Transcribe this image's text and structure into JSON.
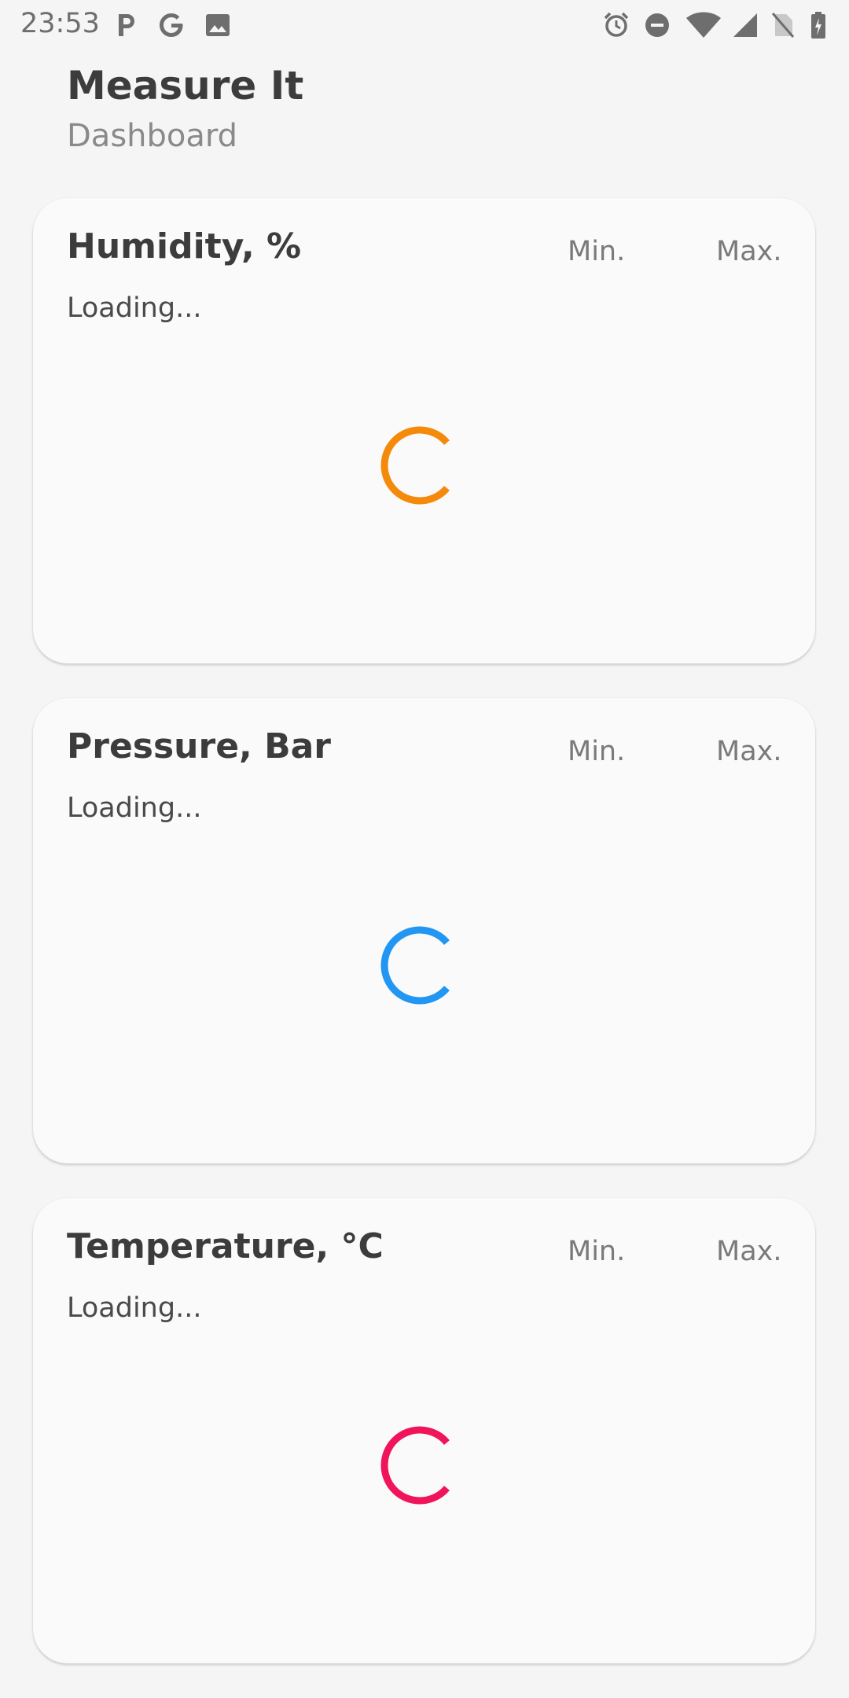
{
  "status_bar": {
    "time": "23:53",
    "left_icons": [
      "parking-icon",
      "google-icon",
      "image-icon"
    ],
    "right_icons": [
      "alarm-icon",
      "do-not-disturb-icon",
      "wifi-icon",
      "cell-signal-icon",
      "no-sim-icon",
      "battery-charging-icon"
    ]
  },
  "header": {
    "title": "Measure It",
    "subtitle": "Dashboard"
  },
  "cards": [
    {
      "title": "Humidity, %",
      "min_label": "Min.",
      "max_label": "Max.",
      "status": "Loading...",
      "spinner_color": "#f5890a"
    },
    {
      "title": "Pressure, Bar",
      "min_label": "Min.",
      "max_label": "Max.",
      "status": "Loading...",
      "spinner_color": "#2196f3"
    },
    {
      "title": "Temperature, °C",
      "min_label": "Min.",
      "max_label": "Max.",
      "status": "Loading...",
      "spinner_color": "#f0145a"
    }
  ]
}
